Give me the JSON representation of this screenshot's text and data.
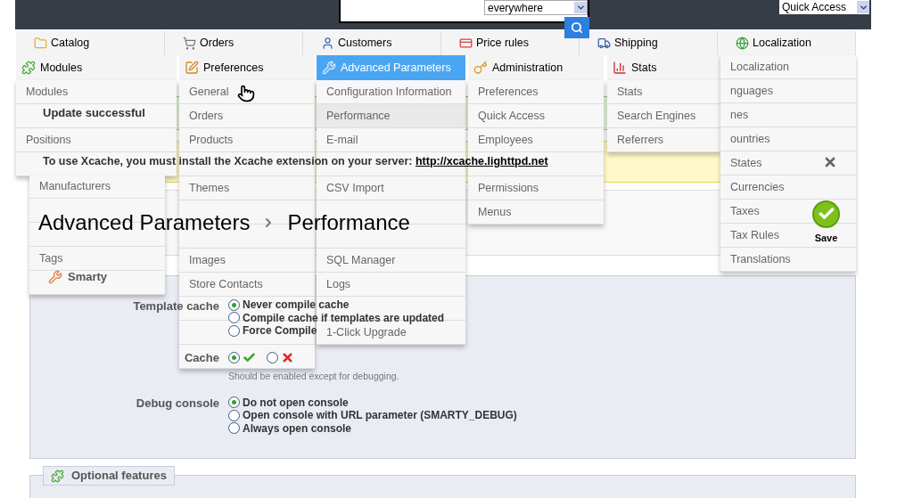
{
  "header": {
    "search": {
      "scope": "everywhere"
    },
    "quick_access": "Quick Access"
  },
  "nav": [
    {
      "label": "Catalog",
      "selected": false
    },
    {
      "label": "Orders",
      "selected": false
    },
    {
      "label": "Customers",
      "selected": false
    },
    {
      "label": "Price rules",
      "selected": false
    },
    {
      "label": "Shipping",
      "selected": false
    },
    {
      "label": "Localization",
      "selected": false
    }
  ],
  "menus": [
    {
      "title": "Modules",
      "selected": false,
      "items": [
        {
          "kind": "link",
          "label": "Modules",
          "selected": false
        },
        {
          "kind": "blank"
        },
        {
          "kind": "link",
          "label": "Positions",
          "selected": false
        },
        {
          "kind": "blank"
        }
      ]
    },
    {
      "items": [
        {
          "kind": "link",
          "label": "Manufacturers",
          "selected": false
        },
        {
          "kind": "blank"
        },
        {
          "kind": "blank"
        },
        {
          "kind": "link",
          "label": "Tags",
          "selected": false
        },
        {
          "kind": "blank"
        }
      ]
    },
    {
      "title": "Preferences",
      "selected": false,
      "items": [
        {
          "kind": "link",
          "label": "General",
          "selected": false
        },
        {
          "kind": "link",
          "label": "Orders",
          "selected": false
        },
        {
          "kind": "link",
          "label": "Products",
          "selected": false
        },
        {
          "kind": "blank"
        },
        {
          "kind": "link",
          "label": "Themes",
          "selected": false
        },
        {
          "kind": "blank"
        },
        {
          "kind": "blank"
        },
        {
          "kind": "link",
          "label": "Images",
          "selected": false
        },
        {
          "kind": "link",
          "label": "Store Contacts",
          "selected": false
        },
        {
          "kind": "blank"
        },
        {
          "kind": "blank"
        },
        {
          "kind": "blank"
        }
      ]
    },
    {
      "title": "Advanced Parameters",
      "selected": true,
      "items": [
        {
          "kind": "link",
          "label": "Configuration Information",
          "selected": false
        },
        {
          "kind": "link",
          "label": "Performance",
          "selected": true
        },
        {
          "kind": "link",
          "label": "E-mail",
          "selected": false
        },
        {
          "kind": "blank"
        },
        {
          "kind": "link",
          "label": "CSV Import",
          "selected": false
        },
        {
          "kind": "blank"
        },
        {
          "kind": "blank"
        },
        {
          "kind": "link",
          "label": "SQL Manager",
          "selected": false
        },
        {
          "kind": "link",
          "label": "Logs",
          "selected": false
        },
        {
          "kind": "blank"
        },
        {
          "kind": "link",
          "label": "1-Click Upgrade",
          "selected": false
        }
      ]
    },
    {
      "title": "Administration",
      "selected": false,
      "items": [
        {
          "kind": "link",
          "label": "Preferences",
          "selected": false
        },
        {
          "kind": "link",
          "label": "Quick Access",
          "selected": false
        },
        {
          "kind": "link",
          "label": "Employees",
          "selected": false
        },
        {
          "kind": "blank"
        },
        {
          "kind": "link",
          "label": "Permissions",
          "selected": false
        },
        {
          "kind": "link",
          "label": "Menus",
          "selected": false
        }
      ]
    },
    {
      "title": "Stats",
      "selected": false,
      "items": [
        {
          "kind": "link",
          "label": "Stats",
          "selected": false
        },
        {
          "kind": "link",
          "label": "Search Engines",
          "selected": false
        },
        {
          "kind": "link",
          "label": "Referrers",
          "selected": false
        }
      ]
    },
    {
      "items": [
        {
          "kind": "link",
          "label": "Localization",
          "selected": false
        },
        {
          "kind": "link",
          "label": "nguages",
          "selected": false
        },
        {
          "kind": "link",
          "label": "nes",
          "selected": false
        },
        {
          "kind": "link",
          "label": "ountries",
          "selected": false
        },
        {
          "kind": "link",
          "label": "States",
          "selected": false
        },
        {
          "kind": "link",
          "label": "Currencies",
          "selected": false
        },
        {
          "kind": "link",
          "label": "Taxes",
          "selected": false
        },
        {
          "kind": "link",
          "label": "Tax Rules",
          "selected": false
        },
        {
          "kind": "link",
          "label": "Translations",
          "selected": false
        }
      ]
    }
  ],
  "messages": {
    "success": "Update successful",
    "warning": {
      "text": "To use Xcache, you must install the Xcache extension on your server:",
      "link": "http://xcache.lighttpd.net"
    }
  },
  "breadcrumb": [
    "Advanced Parameters",
    "Performance"
  ],
  "save": "Save",
  "smarty": {
    "legend": "Smarty",
    "fields": [
      {
        "kind": "radio-list",
        "label": "Template cache",
        "options": [
          {
            "label": "Never compile cache",
            "selected": true
          },
          {
            "label": "Compile cache if templates are updated",
            "selected": false
          },
          {
            "label": "Force Compile",
            "selected": false
          }
        ]
      },
      {
        "kind": "toggle",
        "label": "Cache",
        "options": [
          {
            "kind": "yes",
            "selected": true
          },
          {
            "kind": "no",
            "selected": false
          }
        ],
        "hint": "Should be enabled except for debugging."
      },
      {
        "kind": "radio-list",
        "label": "Debug console",
        "options": [
          {
            "label": "Do not open console",
            "selected": true
          },
          {
            "label": "Open console with URL parameter (SMARTY_DEBUG)",
            "selected": false
          },
          {
            "label": "Always open console",
            "selected": false
          }
        ]
      }
    ]
  },
  "optional": {
    "legend": "Optional features"
  }
}
